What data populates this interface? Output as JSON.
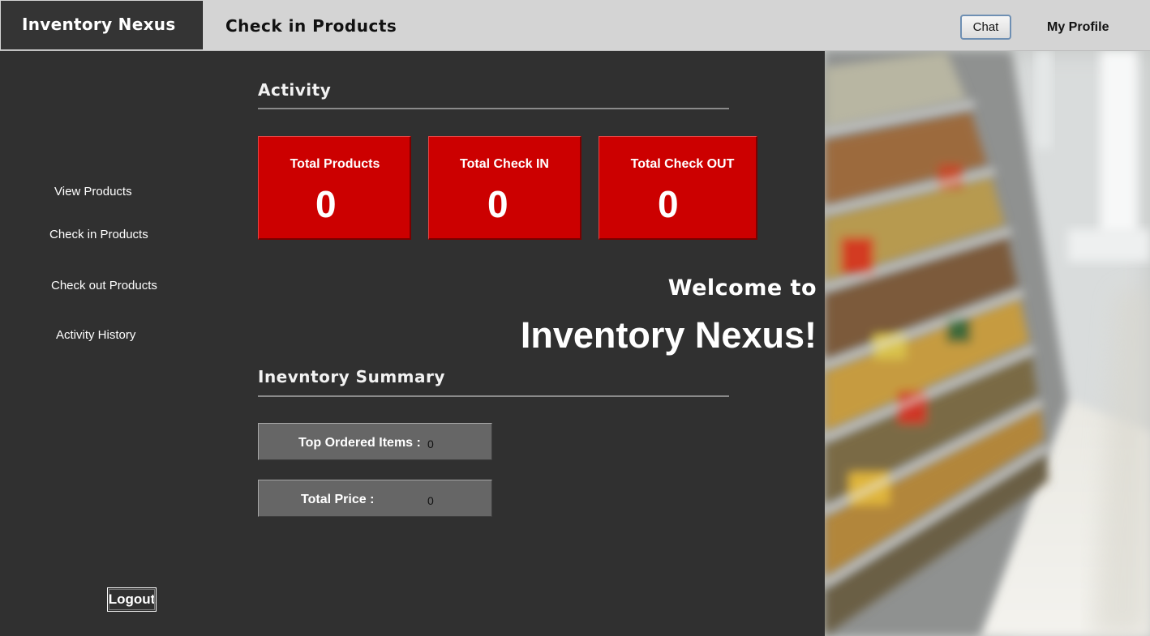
{
  "app": {
    "brand": "Inventory Nexus",
    "page_title": "Check in Products"
  },
  "header": {
    "chat_label": "Chat",
    "profile_label": "My Profile"
  },
  "sidebar": {
    "items": [
      {
        "label": "View Products"
      },
      {
        "label": "Check in Products"
      },
      {
        "label": "Check out Products"
      },
      {
        "label": "Activity History"
      }
    ],
    "logout_label": "Logout"
  },
  "activity": {
    "heading": "Activity",
    "cards": [
      {
        "label": "Total Products",
        "value": "0"
      },
      {
        "label": "Total Check IN",
        "value": "0"
      },
      {
        "label": "Total Check OUT",
        "value": "0"
      }
    ]
  },
  "welcome": {
    "line1": "Welcome to",
    "line2": "Inventory Nexus!"
  },
  "summary": {
    "heading": "Inevntory Summary",
    "top_ordered_label": "Top Ordered Items :",
    "top_ordered_value": "0",
    "total_price_label": "Total Price :",
    "total_price_value": "0"
  },
  "colors": {
    "card_red": "#cc0000",
    "panel_dark": "#303030",
    "topbar_grey": "#d4d4d4",
    "summary_grey": "#666666"
  },
  "icons": {
    "photo": "supermarket-aisle-photo"
  }
}
